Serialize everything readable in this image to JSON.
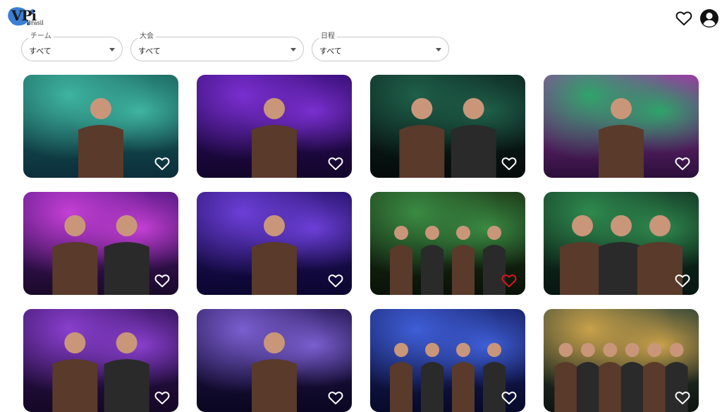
{
  "header": {
    "logo_text": "VPi",
    "logo_sub": "Brasil",
    "icons": [
      "heart-outline-icon",
      "account-circle-icon"
    ]
  },
  "filters": [
    {
      "label": "チーム",
      "value": "すべて"
    },
    {
      "label": "大会",
      "value": "すべて"
    },
    {
      "label": "日程",
      "value": "すべて"
    }
  ],
  "photos": [
    {
      "scene": "player-with-logo-backdrop",
      "favorite": false,
      "colors": [
        "#3fb4a0",
        "#1d6b63",
        "#0b2e3b"
      ]
    },
    {
      "scene": "player-at-gaming-booth",
      "favorite": false,
      "colors": [
        "#7a2fd0",
        "#3a0f7a",
        "#12052a"
      ]
    },
    {
      "scene": "players-on-stage",
      "favorite": false,
      "colors": [
        "#1f5f4a",
        "#0e2b23",
        "#050b0a"
      ]
    },
    {
      "scene": "caster-with-headset",
      "favorite": false,
      "colors": [
        "#2fa46a",
        "#a03aa8",
        "#2b0f3a"
      ]
    },
    {
      "scene": "fans-posing",
      "favorite": false,
      "colors": [
        "#c53fd6",
        "#5b1a8a",
        "#1a0a2a"
      ]
    },
    {
      "scene": "player-raising-arm",
      "favorite": false,
      "colors": [
        "#6c3fd8",
        "#2b1572",
        "#0b0630"
      ]
    },
    {
      "scene": "team-at-computers",
      "favorite": true,
      "colors": [
        "#3a8b43",
        "#1f3b1a",
        "#0a1208"
      ]
    },
    {
      "scene": "team-celebrating",
      "favorite": false,
      "colors": [
        "#2f8a4e",
        "#163b28",
        "#071611"
      ]
    },
    {
      "scene": "players-portrait-purple",
      "favorite": false,
      "colors": [
        "#8a3fcf",
        "#3a1663",
        "#150826"
      ]
    },
    {
      "scene": "player-smiling-at-desk",
      "favorite": false,
      "colors": [
        "#7a5fd0",
        "#2a1a5a",
        "#0a0620"
      ]
    },
    {
      "scene": "group-on-stage-blue",
      "favorite": false,
      "colors": [
        "#3f5fd8",
        "#1b2670",
        "#080a2a"
      ]
    },
    {
      "scene": "team-trophy-celebration",
      "favorite": false,
      "colors": [
        "#c9a14a",
        "#3a4a3a",
        "#0e1410"
      ]
    }
  ],
  "accent": "#e0141e"
}
